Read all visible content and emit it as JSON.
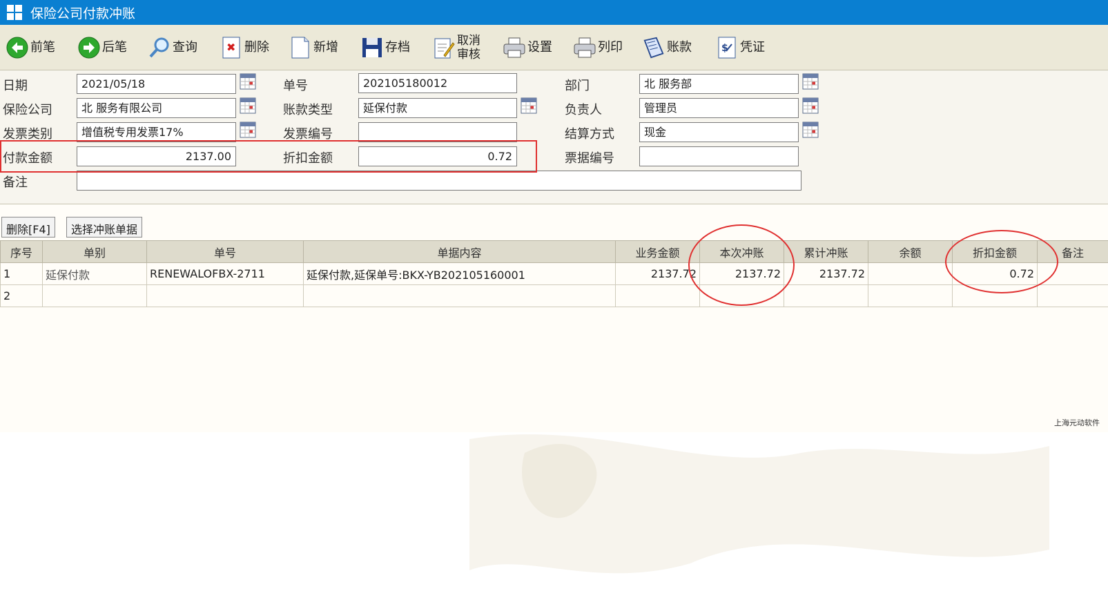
{
  "window": {
    "title": "保险公司付款冲账"
  },
  "toolbar": {
    "prev": "前笔",
    "next": "后笔",
    "query": "查询",
    "delete": "删除",
    "add": "新增",
    "save": "存档",
    "cancel_audit_line1": "取消",
    "cancel_audit_line2": "审核",
    "settings": "设置",
    "print": "列印",
    "account": "账款",
    "voucher": "凭证"
  },
  "form": {
    "date_label": "日期",
    "date_value": "2021/05/18",
    "bill_no_label": "单号",
    "bill_no_value": "202105180012",
    "dept_label": "部门",
    "dept_value": "北 服务部",
    "insurer_label": "保险公司",
    "insurer_value": "北 服务有限公司",
    "account_type_label": "账款类型",
    "account_type_value": "延保付款",
    "owner_label": "负责人",
    "owner_value": "管理员",
    "invoice_type_label": "发票类别",
    "invoice_type_value": "增值税专用发票17%",
    "invoice_no_label": "发票编号",
    "invoice_no_value": "",
    "settle_label": "结算方式",
    "settle_value": "现金",
    "pay_amount_label": "付款金额",
    "pay_amount_value": "2137.00",
    "discount_label": "折扣金额",
    "discount_value": "0.72",
    "note_no_label": "票据编号",
    "note_no_value": "",
    "remark_label": "备注",
    "remark_value": ""
  },
  "grid": {
    "delete_btn": "删除[F4]",
    "select_btn": "选择冲账单据",
    "headers": [
      "序号",
      "单别",
      "单号",
      "单据内容",
      "业务金额",
      "本次冲账",
      "累计冲账",
      "余额",
      "折扣金额",
      "备注"
    ],
    "rows": [
      [
        "1",
        "延保付款",
        "RENEWALOFBX-2711",
        "延保付款,延保单号:BKX-YB202105160001",
        "2137.72",
        "2137.72",
        "2137.72",
        "",
        "0.72",
        ""
      ],
      [
        "2",
        "",
        "",
        "",
        "",
        "",
        "",
        "",
        "",
        ""
      ]
    ]
  },
  "footer": {
    "brand": "上海元动软件"
  },
  "colors": {
    "titlebar": "#0a7fd1",
    "toolbar_bg": "#ece9d8",
    "annotation_red": "#e03030"
  }
}
